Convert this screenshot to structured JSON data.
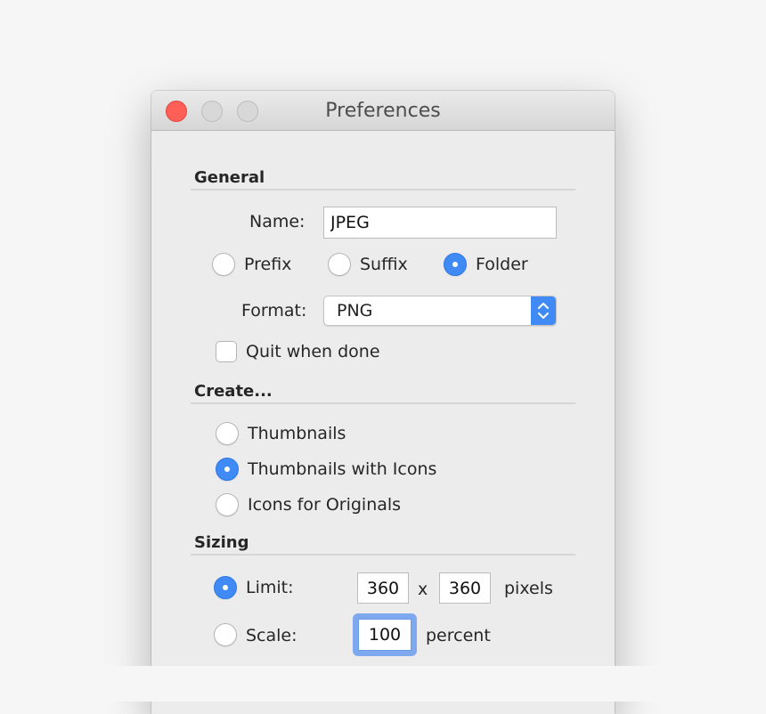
{
  "window": {
    "title": "Preferences",
    "traffic_lights": [
      "close",
      "minimize",
      "zoom"
    ]
  },
  "general": {
    "heading": "General",
    "name_label": "Name:",
    "name_value": "JPEG",
    "placement_options": [
      {
        "label": "Prefix",
        "selected": false
      },
      {
        "label": "Suffix",
        "selected": false
      },
      {
        "label": "Folder",
        "selected": true
      }
    ],
    "format_label": "Format:",
    "format_value": "PNG",
    "quit_label": "Quit when done",
    "quit_checked": false
  },
  "create": {
    "heading": "Create...",
    "options": [
      {
        "label": "Thumbnails",
        "selected": false
      },
      {
        "label": "Thumbnails with Icons",
        "selected": true
      },
      {
        "label": "Icons for Originals",
        "selected": false
      }
    ]
  },
  "sizing": {
    "heading": "Sizing",
    "limit_label": "Limit:",
    "limit_selected": true,
    "limit_width": "360",
    "times": "x",
    "limit_height": "360",
    "pixels_label": "pixels",
    "scale_label": "Scale:",
    "scale_selected": false,
    "scale_value": "100",
    "percent_label": "percent"
  },
  "colors": {
    "accent": "#3f8af5",
    "close_light": "#fe5f57",
    "window_bg": "#ececec"
  }
}
